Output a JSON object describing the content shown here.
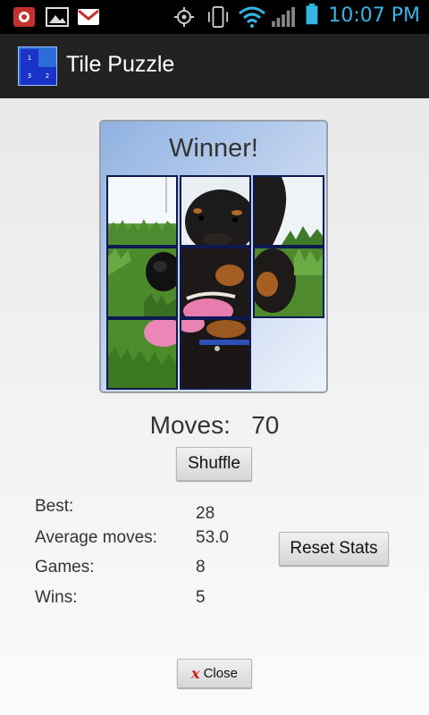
{
  "status_bar": {
    "time": "10:07 PM",
    "accent_color": "#33b5e5",
    "left_icons": [
      "notification-cloud-icon",
      "gallery-icon",
      "gmail-icon"
    ],
    "right_icons": [
      "gps-icon",
      "vibrate-icon",
      "wifi-icon",
      "signal-icon",
      "battery-icon"
    ]
  },
  "action_bar": {
    "title": "Tile Puzzle",
    "app_icon_numbers": [
      "1",
      "3",
      "2"
    ]
  },
  "puzzle": {
    "status": "Winner!",
    "tiles": [
      "tile-grass-top",
      "tile-dog-head",
      "tile-dog-ear",
      "tile-dog-nose",
      "tile-dog-mouth",
      "tile-dog-cheek",
      "tile-tongue-grass",
      "tile-dog-collar",
      "empty"
    ]
  },
  "moves": {
    "label": "Moves:",
    "value": "70"
  },
  "buttons": {
    "shuffle": "Shuffle",
    "reset_stats": "Reset Stats",
    "close": "Close"
  },
  "stats": [
    {
      "label": "Best:",
      "value": "28"
    },
    {
      "label": "Average moves:",
      "value": "53.0"
    },
    {
      "label": "Games:",
      "value": "8"
    },
    {
      "label": "Wins:",
      "value": "5"
    }
  ]
}
